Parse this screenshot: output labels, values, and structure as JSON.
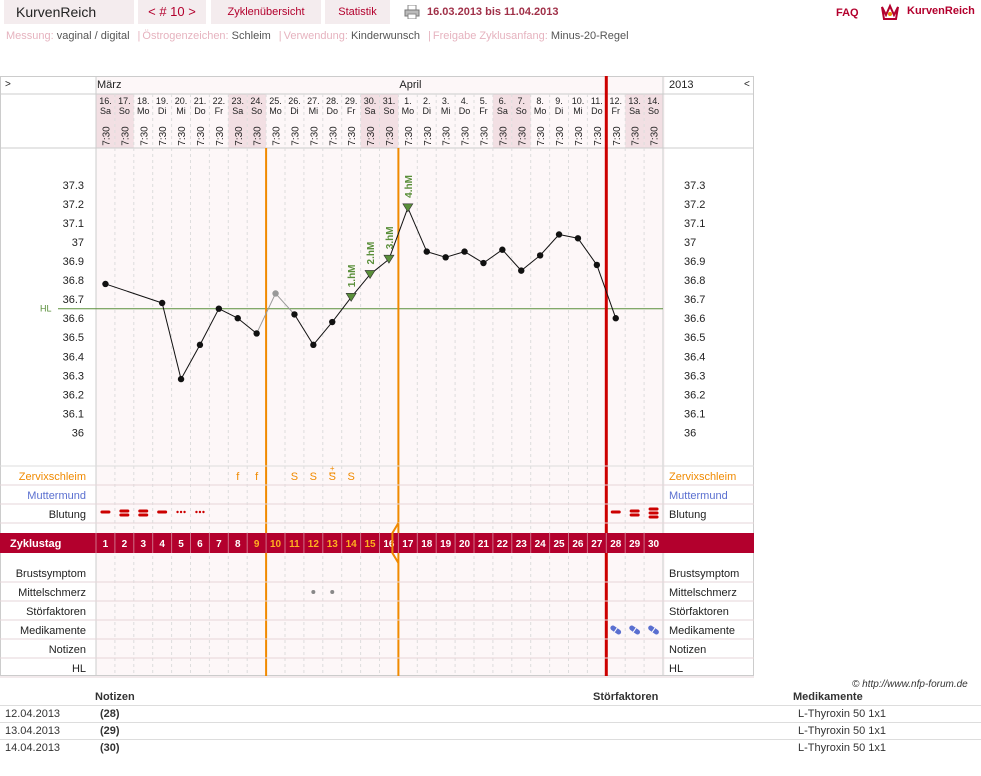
{
  "topbar": {
    "brand": "KurvenReich",
    "cycle_nav": "< # 10 >",
    "tab_overview": "Zyklenübersicht",
    "tab_stats": "Statistik",
    "date_range": "16.03.2013 bis 11.04.2013",
    "faq": "FAQ",
    "logo_text": "KurvenReich"
  },
  "settings": [
    {
      "key": "Messung:",
      "value": "vaginal / digital"
    },
    {
      "key": "Östrogenzeichen:",
      "value": "Schleim"
    },
    {
      "key": "Verwendung:",
      "value": "Kinderwunsch"
    },
    {
      "key": "Freigabe Zyklusanfang:",
      "value": "Minus-20-Regel"
    }
  ],
  "chart_data": {
    "type": "line",
    "nav_left": ">",
    "nav_right": "<",
    "year": "2013",
    "months": [
      {
        "label": "März",
        "col": 0
      },
      {
        "label": "April",
        "col": 16
      }
    ],
    "dates": [
      "16.",
      "17.",
      "18.",
      "19.",
      "20.",
      "21.",
      "22.",
      "23.",
      "24.",
      "25.",
      "26.",
      "27.",
      "28.",
      "29.",
      "30.",
      "31.",
      "1.",
      "2.",
      "3.",
      "4.",
      "5.",
      "6.",
      "7.",
      "8.",
      "9.",
      "10.",
      "11.",
      "12.",
      "13.",
      "14."
    ],
    "weekdays": [
      "Sa",
      "So",
      "Mo",
      "Di",
      "Mi",
      "Do",
      "Fr",
      "Sa",
      "So",
      "Mo",
      "Di",
      "Mi",
      "Do",
      "Fr",
      "Sa",
      "So",
      "Mo",
      "Di",
      "Mi",
      "Do",
      "Fr",
      "Sa",
      "So",
      "Mo",
      "Di",
      "Mi",
      "Do",
      "Fr",
      "Sa",
      "So"
    ],
    "times": "7:30",
    "weekend_cols": [
      0,
      1,
      7,
      8,
      14,
      15,
      21,
      22,
      28,
      29
    ],
    "cycle_days": [
      "1",
      "2",
      "3",
      "4",
      "5",
      "6",
      "7",
      "8",
      "9",
      "10",
      "11",
      "12",
      "13",
      "14",
      "15",
      "16",
      "17",
      "18",
      "19",
      "20",
      "21",
      "22",
      "23",
      "24",
      "25",
      "26",
      "27",
      "28",
      "29",
      "30"
    ],
    "y_ticks": [
      "37.3",
      "37.2",
      "37.1",
      "37",
      "36.9",
      "36.8",
      "36.7",
      "36.6",
      "36.5",
      "36.4",
      "36.3",
      "36.2",
      "36.1",
      "36"
    ],
    "ylim": [
      36.0,
      37.3
    ],
    "hl_label": "HL",
    "hl_value": 36.65,
    "temps": [
      36.78,
      null,
      null,
      36.68,
      36.28,
      36.46,
      36.65,
      36.6,
      36.52,
      36.73,
      36.62,
      36.46,
      36.58,
      36.71,
      36.83,
      36.91,
      37.18,
      36.95,
      36.92,
      36.95,
      36.89,
      36.96,
      36.85,
      36.93,
      37.04,
      37.02,
      36.88,
      36.6,
      null,
      null
    ],
    "excluded_cols": [
      9
    ],
    "hm_labels": [
      {
        "col": 13,
        "label": "1.hM"
      },
      {
        "col": 14,
        "label": "2.hM"
      },
      {
        "col": 15,
        "label": "3.hM"
      },
      {
        "col": 16,
        "label": "4.hM"
      }
    ],
    "orange_lines": [
      8,
      15
    ],
    "red_line_col": 27,
    "highlight_days": [
      8,
      9,
      10,
      11,
      12,
      13,
      14
    ],
    "rows": {
      "zervix": "Zervixschleim",
      "muttermund": "Muttermund",
      "blutung": "Blutung",
      "zyklustag": "Zyklustag",
      "brust": "Brustsymptom",
      "mittel": "Mittelschmerz",
      "stoer": "Störfaktoren",
      "medi": "Medikamente",
      "notizen": "Notizen",
      "hl": "HL"
    },
    "zervix_marks": [
      {
        "col": 7,
        "s": "f"
      },
      {
        "col": 8,
        "s": "f"
      },
      {
        "col": 10,
        "s": "S"
      },
      {
        "col": 11,
        "s": "S"
      },
      {
        "col": 12,
        "s": "S+"
      },
      {
        "col": 13,
        "s": "S"
      }
    ],
    "bleeding": [
      {
        "col": 0,
        "kind": "single"
      },
      {
        "col": 1,
        "kind": "double"
      },
      {
        "col": 2,
        "kind": "double"
      },
      {
        "col": 3,
        "kind": "single"
      },
      {
        "col": 4,
        "kind": "dots"
      },
      {
        "col": 5,
        "kind": "dots"
      },
      {
        "col": 27,
        "kind": "single"
      },
      {
        "col": 28,
        "kind": "double"
      },
      {
        "col": 29,
        "kind": "triple"
      }
    ],
    "mittelschmerz_cols": [
      11,
      12
    ],
    "med_cols": [
      27,
      28,
      29
    ]
  },
  "credit": "© http://www.nfp-forum.de",
  "notes": {
    "headers": {
      "notizen": "Notizen",
      "stoer": "Störfaktoren",
      "medi": "Medikamente"
    },
    "rows": [
      {
        "date": "12.04.2013",
        "day": "(28)",
        "med": "L-Thyroxin 50 1x1"
      },
      {
        "date": "13.04.2013",
        "day": "(29)",
        "med": "L-Thyroxin 50 1x1"
      },
      {
        "date": "14.04.2013",
        "day": "(30)",
        "med": "L-Thyroxin 50 1x1"
      }
    ]
  },
  "colors": {
    "accent": "#b3002d",
    "orange": "#f08a00",
    "red": "#cc0000",
    "green": "#5a8f3a",
    "blue": "#5a6fd0"
  }
}
